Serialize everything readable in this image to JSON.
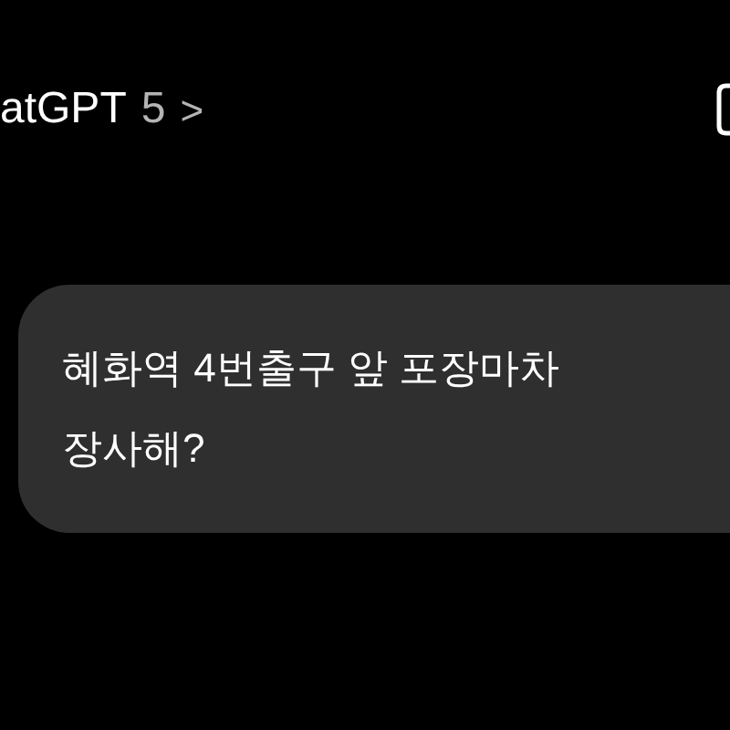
{
  "header": {
    "title": "atGPT",
    "model": "5",
    "chevron": ">"
  },
  "user_message": {
    "text": "혜화역 4번출구 앞 포장마차\n장사해?"
  }
}
